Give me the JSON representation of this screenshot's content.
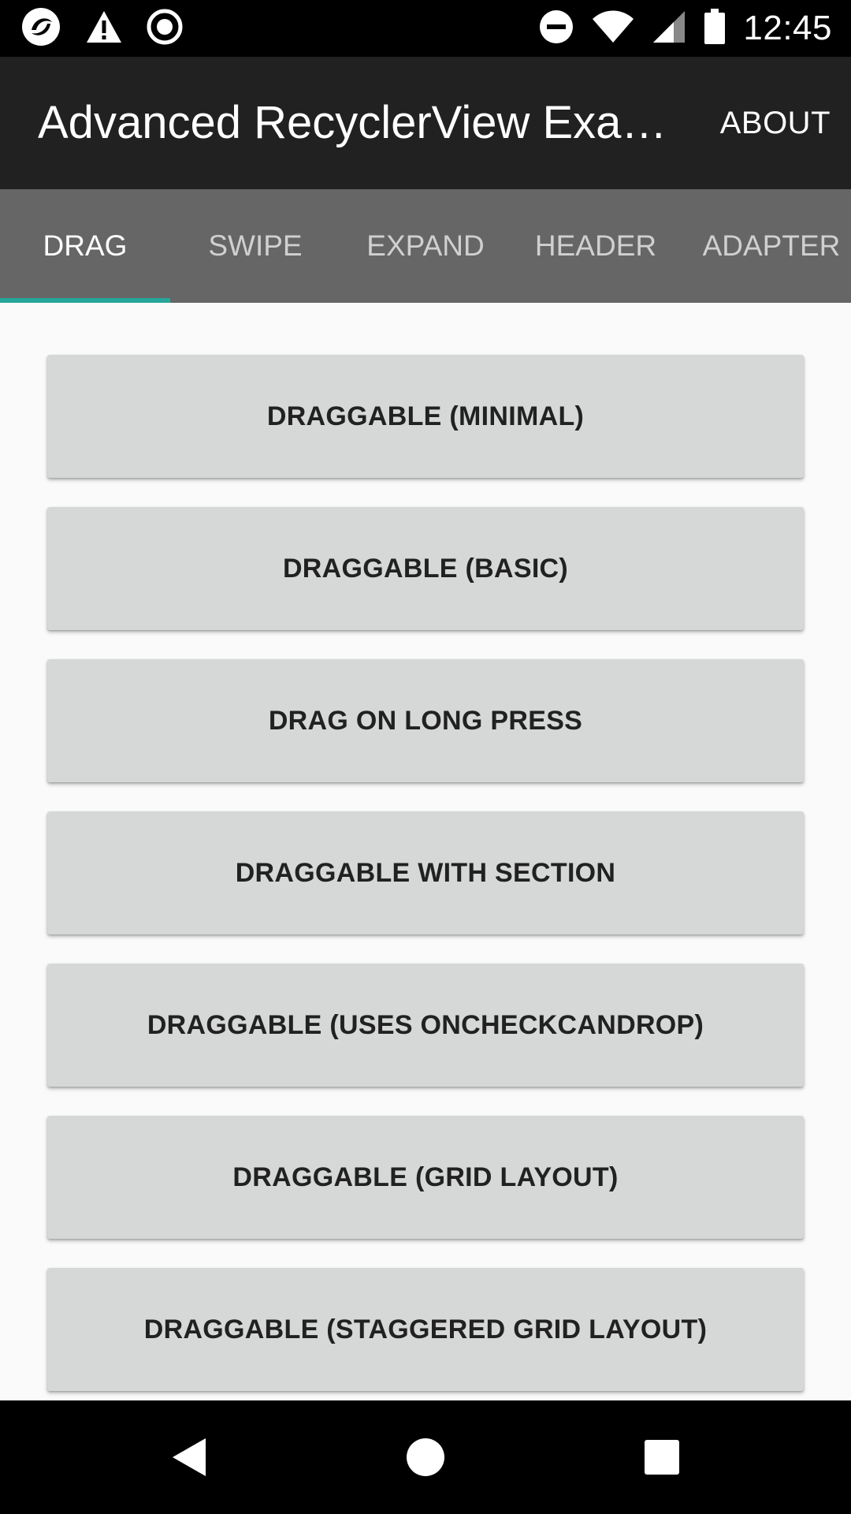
{
  "status_bar": {
    "time": "12:45",
    "icons_left": [
      "app-notification-icon",
      "warning-icon",
      "record-icon"
    ],
    "icons_right": [
      "do-not-disturb-icon",
      "wifi-icon",
      "signal-icon",
      "battery-icon"
    ]
  },
  "app_bar": {
    "title": "Advanced RecyclerView Exa…",
    "action_label": "ABOUT"
  },
  "tabs": [
    {
      "label": "DRAG",
      "selected": true
    },
    {
      "label": "SWIPE",
      "selected": false
    },
    {
      "label": "EXPAND",
      "selected": false
    },
    {
      "label": "HEADER",
      "selected": false
    },
    {
      "label": "ADAPTER",
      "selected": false
    }
  ],
  "buttons": [
    {
      "label": "DRAGGABLE (MINIMAL)"
    },
    {
      "label": "DRAGGABLE (BASIC)"
    },
    {
      "label": "DRAG ON LONG PRESS"
    },
    {
      "label": "DRAGGABLE WITH SECTION"
    },
    {
      "label": "DRAGGABLE (USES ONCHECKCANDROP)"
    },
    {
      "label": "DRAGGABLE (GRID LAYOUT)"
    },
    {
      "label": "DRAGGABLE (STAGGERED GRID LAYOUT)"
    }
  ],
  "nav_bar": {
    "icons": [
      "back-icon",
      "home-icon",
      "recents-icon"
    ]
  },
  "colors": {
    "app_bar": "#212121",
    "tab_bar": "#666666",
    "tab_indicator": "#26a69a",
    "button_bg": "#d6d7d7",
    "background": "#fafafa"
  }
}
